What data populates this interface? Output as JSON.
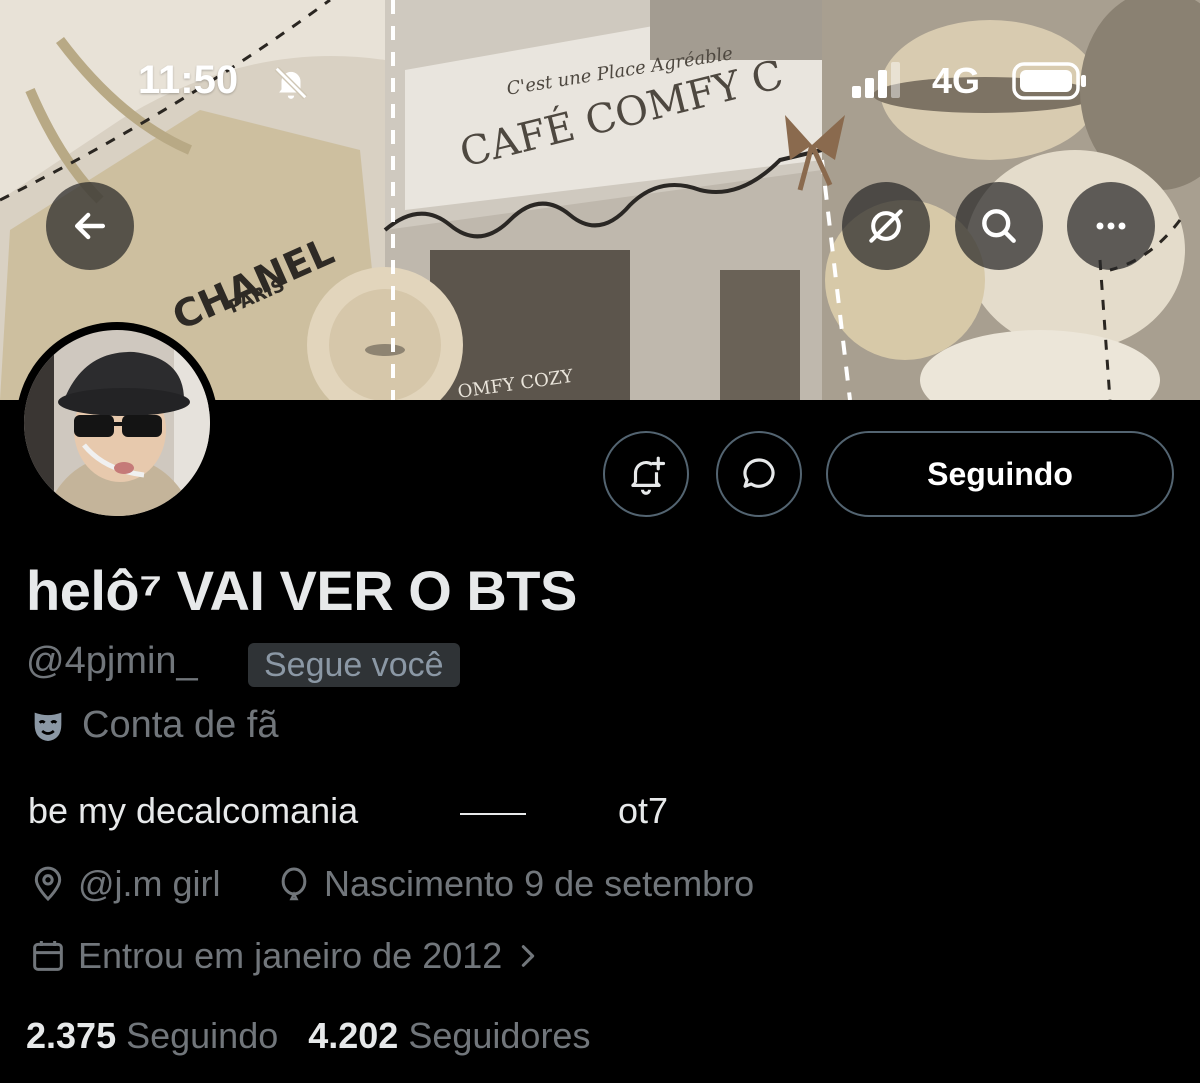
{
  "status_bar": {
    "time": "11:50",
    "network": "4G"
  },
  "banner": {
    "bag_brand": "CHANEL",
    "bag_city": "PARIS",
    "cafe_tagline": "C'est une Place Agréable",
    "cafe_sign": "CAFÉ COMFY C",
    "cafe_window": "OMFY COZY"
  },
  "header_buttons": {
    "back_icon": "arrow-left-icon",
    "notifications_icon": "bell-off-icon",
    "search_icon": "search-icon",
    "more_icon": "more-horizontal-icon"
  },
  "actions": {
    "alert_icon": "bell-plus-icon",
    "message_icon": "message-icon",
    "follow_label": "Seguindo"
  },
  "profile": {
    "display_name": "helô⁷ VAI VER O BTS",
    "handle": "@4pjmin_",
    "follows_you": "Segue você",
    "category": "Conta de fã",
    "bio_left": "be my decalcomania",
    "bio_right": "ot7",
    "location": "@j.m girl",
    "birth": "Nascimento 9 de setembro",
    "joined": "Entrou em janeiro de 2012"
  },
  "stats": {
    "following_count": "2.375",
    "following_label": "Seguindo",
    "followers_count": "4.202",
    "followers_label": "Seguidores"
  },
  "colors": {
    "background": "#000000",
    "text": "#e7e9ea",
    "muted": "#71767b",
    "border": "#536471"
  }
}
